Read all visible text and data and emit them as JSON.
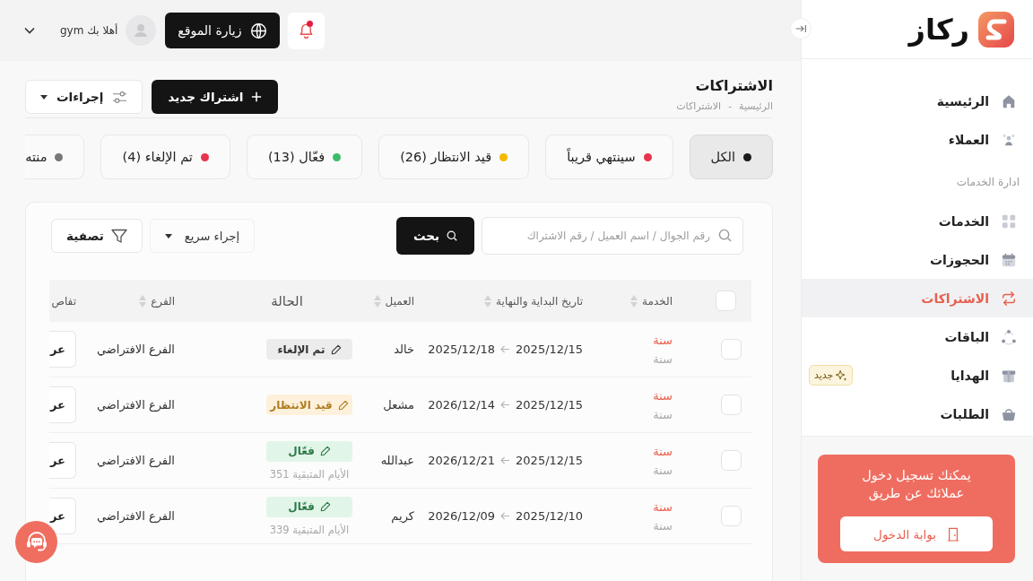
{
  "sidebar": {
    "logo": "ركاز",
    "items": [
      {
        "kind": "link",
        "label": "الرئيسية",
        "selected": false
      },
      {
        "kind": "link",
        "label": "العملاء",
        "selected": false
      },
      {
        "kind": "section",
        "label": "ادارة الخدمات"
      },
      {
        "kind": "link",
        "label": "الخدمات",
        "selected": false
      },
      {
        "kind": "link",
        "label": "الحجوزات",
        "selected": false
      },
      {
        "kind": "link",
        "label": "الاشتراكات",
        "selected": true
      },
      {
        "kind": "link",
        "label": "الباقات",
        "selected": false
      },
      {
        "kind": "link",
        "label": "الهدايا",
        "selected": false,
        "badge": "جديد"
      },
      {
        "kind": "link",
        "label": "الطلبات",
        "selected": false
      }
    ],
    "promo": {
      "text": "يمكنك تسجيل دخول عملائك عن طريق",
      "button": "بوابة الدخول"
    }
  },
  "topbar": {
    "notifications_unread": true,
    "visit_button": "زيارة الموقع",
    "user_greeting": "أهلا بك gym"
  },
  "page": {
    "title": "الاشتراكات",
    "breadcrumb": {
      "items": [
        "الرئيسية",
        "الاشتراكات"
      ],
      "separator": "-"
    },
    "new_button": "اشتراك جديد",
    "actions_button": "إجراءات"
  },
  "tabs": [
    {
      "label": "الكل",
      "color": "#1a1a1a",
      "selected": true
    },
    {
      "label": "سينتهي قريباً",
      "color": "#e8334d",
      "selected": false
    },
    {
      "label": "قيد الانتظار (26)",
      "color": "#f5b800",
      "selected": false
    },
    {
      "label": "فعّال (13)",
      "color": "#3dbb6c",
      "selected": false
    },
    {
      "label": "تم الإلغاء (4)",
      "color": "#e8334d",
      "selected": false
    },
    {
      "label": "منته",
      "color": "#777777",
      "selected": false
    }
  ],
  "toolbar": {
    "search_placeholder": "رقم الجوال / اسم العميل / رقم الاشتراك",
    "search_button": "بحث",
    "quick_action": "إجراء سريع",
    "filter_button": "تصفية"
  },
  "table": {
    "select_all": {
      "checked": false
    },
    "columns": [
      {
        "label": "الخدمة",
        "sortable": true
      },
      {
        "label": "تاريخ البداية والنهاية",
        "sortable": true
      },
      {
        "label": "العميل",
        "sortable": true
      },
      {
        "label": "الحالة",
        "sortable": false
      },
      {
        "label": "الفرع",
        "sortable": true
      },
      {
        "label": "تفاص",
        "sortable": false
      }
    ],
    "rows": [
      {
        "checked": false,
        "service": "سنة",
        "service_type": "سنة",
        "start": "2025/12/15",
        "end": "2025/12/18",
        "customer": "خالد",
        "status": {
          "kind": "cancelled",
          "label": "تم الإلغاء"
        },
        "branch": "الفرع الافتراضي",
        "details": "عر"
      },
      {
        "checked": false,
        "service": "سنة",
        "service_type": "سنة",
        "start": "2025/12/15",
        "end": "2026/12/14",
        "customer": "مشعل",
        "status": {
          "kind": "pending",
          "label": "قيد الانتظار"
        },
        "branch": "الفرع الافتراضي",
        "details": "عر"
      },
      {
        "checked": false,
        "service": "سنة",
        "service_type": "سنة",
        "start": "2025/12/15",
        "end": "2026/12/21",
        "customer": "عبدالله",
        "status": {
          "kind": "active",
          "label": "فعّال"
        },
        "remaining": "الأيام المتبقية 351",
        "branch": "الفرع الافتراضي",
        "details": "عر"
      },
      {
        "checked": false,
        "service": "سنة",
        "service_type": "سنة",
        "start": "2025/12/10",
        "end": "2026/12/09",
        "customer": "كريم",
        "status": {
          "kind": "active",
          "label": "فعّال"
        },
        "remaining": "الأيام المتبقية 339",
        "branch": "الفرع الافتراضي",
        "details": "عر"
      }
    ]
  }
}
